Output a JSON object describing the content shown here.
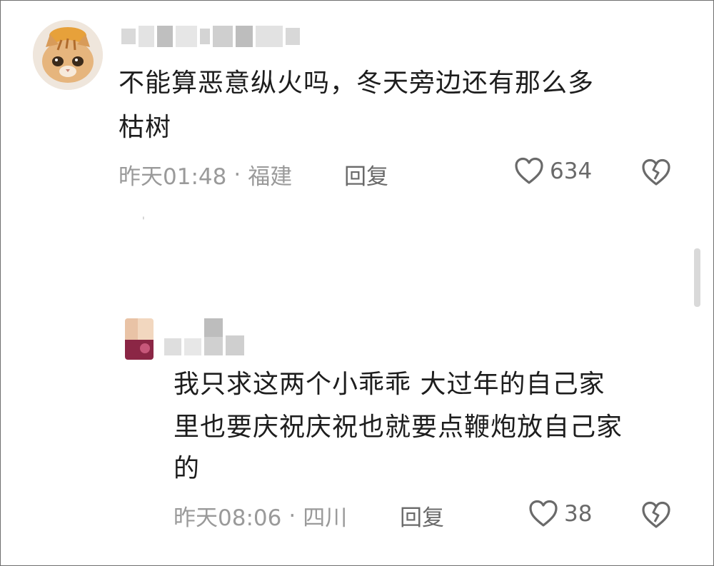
{
  "comments": [
    {
      "text_line1": "不能算恶意纵火吗，冬天旁边还有那么多",
      "text_line2": "枯树",
      "time": "昨天01:48",
      "separator": "·",
      "location": "福建",
      "reply_label": "回复",
      "like_count": "634",
      "like_icon": "heart-outline-icon",
      "dislike_icon": "broken-heart-icon"
    },
    {
      "text_line1": "我只求这两个小乖乖 大过年的自己家",
      "text_line2": "里也要庆祝庆祝也就要点鞭炮放自己家",
      "text_line3": "的",
      "time": "昨天08:06",
      "separator": "·",
      "location": "四川",
      "reply_label": "回复",
      "like_count": "38",
      "like_icon": "heart-outline-icon",
      "dislike_icon": "broken-heart-icon"
    }
  ],
  "colors": {
    "text": "#1d1d1d",
    "meta": "#9a9a9a",
    "action": "#6a6a6a"
  }
}
